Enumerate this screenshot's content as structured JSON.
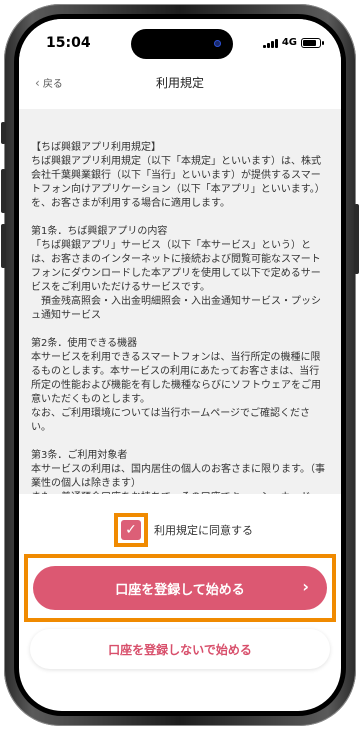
{
  "status_bar": {
    "time": "15:04",
    "network": "4G"
  },
  "nav": {
    "back_label": "戻る",
    "title": "利用規定"
  },
  "terms": {
    "text": "【ちば興銀アプリ利用規定】\nちば興銀アプリ利用規定（以下「本規定」といいます）は、株式会社千葉興業銀行（以下「当行」といいます）が提供するスマートフォン向けアプリケーション（以下「本アプリ」といいます。）を、お客さまが利用する場合に適用します。\n\n第1条．ちば興銀アプリの内容\n「ちば興銀アプリ」サービス（以下「本サービス」という）とは、お客さまのインターネットに接続および閲覧可能なスマートフォンにダウンロードした本アプリを使用して以下で定めるサービスをご利用いただけるサービスです。\n　預金残高照会・入出金明細照会・入出金通知サービス・プッシュ通知サービス\n\n第2条．使用できる機器\n本サービスを利用できるスマートフォンは、当行所定の機種に限るものとします。本サービスの利用にあたってお客さまは、当行所定の性能および機能を有した機種ならびにソフトウェアをご用意いただくものとします。\nなお、ご利用環境については当行ホームページでご確認ください。\n\n第3条．ご利用対象者\n本サービスの利用は、国内居住の個人のお客さまに限ります。（事業性の個人は除きます）\nまた、普通預金口座をお持ちで、その口座でキャッシュカード"
  },
  "agreement": {
    "label": "利用規定に同意する",
    "checked": true,
    "check_glyph": "✓"
  },
  "buttons": {
    "register_label": "口座を登録して始める",
    "register_chevron": "›",
    "no_register_label": "口座を登録しないで始める"
  },
  "colors": {
    "accent": "#dc5872",
    "highlight": "#f08a00",
    "secondary_text": "#d84f6b"
  }
}
